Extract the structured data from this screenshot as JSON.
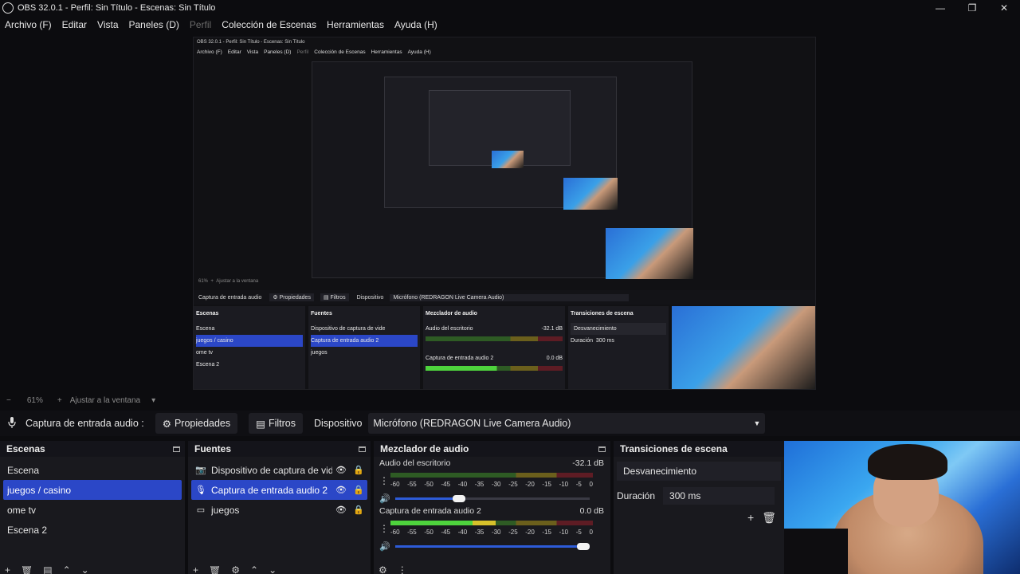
{
  "window": {
    "title": "OBS 32.0.1 - Perfil: Sin Título - Escenas: Sin Título",
    "controls": {
      "minimize": "—",
      "maximize": "❐",
      "close": "✕"
    }
  },
  "menu": [
    "Archivo (F)",
    "Editar",
    "Vista",
    "Paneles (D)",
    "Perfil",
    "Colección de Escenas",
    "Herramientas",
    "Ayuda (H)"
  ],
  "preview_nested": {
    "title": "OBS 32.0.1 - Perfil: Sin Título - Escenas: Sin Título",
    "menu": [
      "Archivo (F)",
      "Editar",
      "Vista",
      "Paneles (D)",
      "Perfil",
      "Colección de Escenas",
      "Herramientas",
      "Ayuda (H)"
    ],
    "zoom": "61%",
    "fit": "Ajustar a la ventana",
    "source_label": "Captura de entrada audio",
    "properties": "Propiedades",
    "filters": "Filtros",
    "device_label": "Dispositivo",
    "device_value": "Micrófono (REDRAGON Live Camera Audio)",
    "docks": {
      "scenes": "Escenas",
      "sources": "Fuentes",
      "mixer": "Mezclador de audio",
      "transitions": "Transiciones de escena"
    },
    "scenes": [
      "Escena",
      "juegos / casino",
      "ome tv",
      "Escena 2"
    ],
    "sources": [
      "Dispositivo de captura de vide",
      "Captura de entrada audio 2",
      "juegos"
    ],
    "mixer": [
      {
        "name": "Audio del escritorio",
        "db": "-32.1 dB"
      },
      {
        "name": "Captura de entrada audio 2",
        "db": "0.0 dB"
      }
    ],
    "transition": "Desvanecimiento",
    "duration_label": "Duración",
    "duration": "300 ms"
  },
  "zoombar": {
    "minus": "−",
    "zoom": "61%",
    "plus": "+",
    "fit": "Ajustar a la ventana",
    "caret": "▾"
  },
  "sourcebar": {
    "mic_icon": "microphone-icon",
    "label": "Captura de entrada audio :",
    "properties": "Propiedades",
    "filters": "Filtros",
    "device_label": "Dispositivo",
    "device_value": "Micrófono (REDRAGON Live Camera Audio)"
  },
  "scenes": {
    "title": "Escenas",
    "items": [
      "Escena",
      "juegos / casino",
      "ome tv",
      "Escena 2"
    ],
    "selected_index": 1
  },
  "sources": {
    "title": "Fuentes",
    "items": [
      {
        "name": "Dispositivo de captura de vide",
        "icon": "camera-icon"
      },
      {
        "name": "Captura de entrada audio 2",
        "icon": "microphone-icon"
      },
      {
        "name": "juegos",
        "icon": "window-icon"
      }
    ],
    "selected_index": 1
  },
  "mixer": {
    "title": "Mezclador de audio",
    "scale": [
      "-60",
      "-55",
      "-50",
      "-45",
      "-40",
      "-35",
      "-30",
      "-25",
      "-20",
      "-15",
      "-10",
      "-5",
      "0"
    ],
    "channels": [
      {
        "name": "Audio del escritorio",
        "db": "-32.1 dB",
        "level": 0,
        "volume": 0.36
      },
      {
        "name": "Captura de entrada audio 2",
        "db": "0.0 dB",
        "level": 0.52,
        "volume": 1.0
      }
    ]
  },
  "transitions": {
    "title": "Transiciones de escena",
    "transition": "Desvanecimiento",
    "duration_label": "Duración",
    "duration": "300 ms"
  },
  "colors": {
    "accent": "#2b47c7",
    "panel": "#19191e",
    "background": "#0c0c0f"
  }
}
